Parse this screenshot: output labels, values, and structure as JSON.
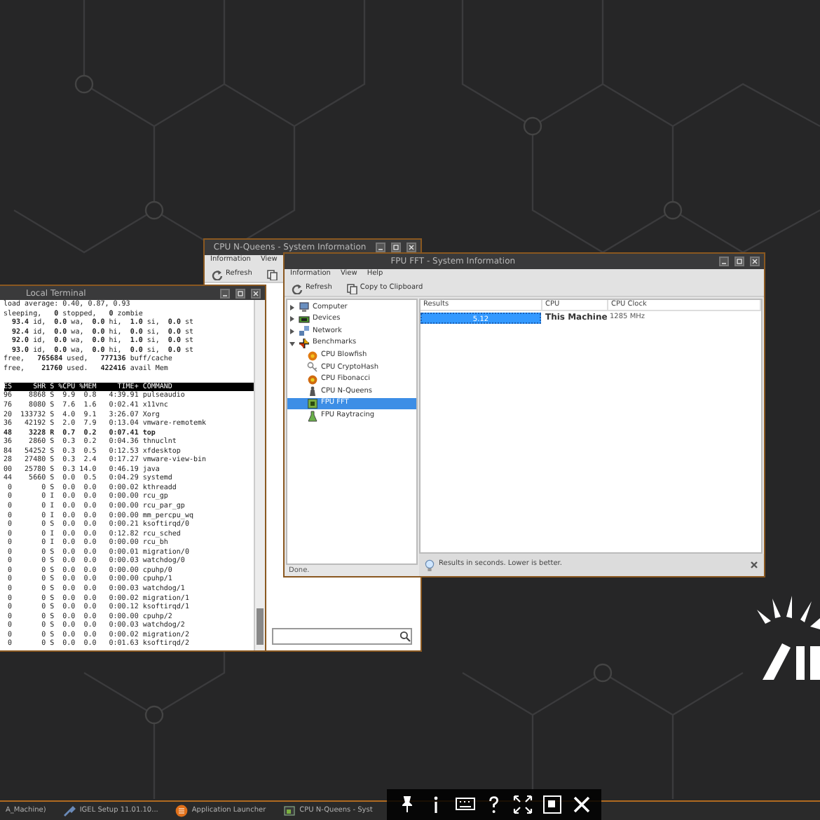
{
  "nqueens_window": {
    "title": "CPU N-Queens - System Information",
    "menu": [
      "Information",
      "View"
    ],
    "toolbar": [
      {
        "label": "Refresh",
        "kind": "refresh"
      },
      {
        "kind": "copy"
      }
    ]
  },
  "terminal": {
    "title": "Local Terminal",
    "summary": [
      "load average: 0.40, 0.87, 0.93",
      "sleeping,   **0** stopped,   **0** zombie",
      "  **93.4** id,  **0.0** wa,  **0.0** hi,  **1.0** si,  **0.0** st",
      "  **92.4** id,  **0.0** wa,  **0.0** hi,  **0.0** si,  **0.0** st",
      "  **92.0** id,  **0.0** wa,  **0.0** hi,  **1.0** si,  **0.0** st",
      "  **93.0** id,  **0.0** wa,  **0.0** hi,  **0.0** si,  **0.0** st",
      "free,   **765684** used,   **777136** buff/cache",
      "free,    **21760** used.   **422416** avail Mem"
    ],
    "header": "ES     SHR S %CPU %MEM     TIME+ COMMAND",
    "processes": [
      {
        "text": "96    8868 S  9.9  0.8   4:39.91 pulseaudio",
        "bold": false
      },
      {
        "text": "76    8080 S  7.6  1.6   0:02.41 x11vnc",
        "bold": false
      },
      {
        "text": "20  133732 S  4.0  9.1   3:26.07 Xorg",
        "bold": false
      },
      {
        "text": "36   42192 S  2.0  7.9   0:13.04 vmware-remotemk",
        "bold": false
      },
      {
        "text": "48    3228 R  0.7  0.2   0:07.41 top",
        "bold": true
      },
      {
        "text": "36    2860 S  0.3  0.2   0:04.36 thnuclnt",
        "bold": false
      },
      {
        "text": "84   54252 S  0.3  0.5   0:12.53 xfdesktop",
        "bold": false
      },
      {
        "text": "28   27480 S  0.3  2.4   0:17.27 vmware-view-bin",
        "bold": false
      },
      {
        "text": "00   25780 S  0.3 14.0   0:46.19 java",
        "bold": false
      },
      {
        "text": "44    5660 S  0.0  0.5   0:04.29 systemd",
        "bold": false
      },
      {
        "text": " 0       0 S  0.0  0.0   0:00.02 kthreadd",
        "bold": false
      },
      {
        "text": " 0       0 I  0.0  0.0   0:00.00 rcu_gp",
        "bold": false
      },
      {
        "text": " 0       0 I  0.0  0.0   0:00.00 rcu_par_gp",
        "bold": false
      },
      {
        "text": " 0       0 I  0.0  0.0   0:00.00 mm_percpu_wq",
        "bold": false
      },
      {
        "text": " 0       0 S  0.0  0.0   0:00.21 ksoftirqd/0",
        "bold": false
      },
      {
        "text": " 0       0 I  0.0  0.0   0:12.82 rcu_sched",
        "bold": false
      },
      {
        "text": " 0       0 I  0.0  0.0   0:00.00 rcu_bh",
        "bold": false
      },
      {
        "text": " 0       0 S  0.0  0.0   0:00.01 migration/0",
        "bold": false
      },
      {
        "text": " 0       0 S  0.0  0.0   0:00.03 watchdog/0",
        "bold": false
      },
      {
        "text": " 0       0 S  0.0  0.0   0:00.00 cpuhp/0",
        "bold": false
      },
      {
        "text": " 0       0 S  0.0  0.0   0:00.00 cpuhp/1",
        "bold": false
      },
      {
        "text": " 0       0 S  0.0  0.0   0:00.03 watchdog/1",
        "bold": false
      },
      {
        "text": " 0       0 S  0.0  0.0   0:00.02 migration/1",
        "bold": false
      },
      {
        "text": " 0       0 S  0.0  0.0   0:00.12 ksoftirqd/1",
        "bold": false
      },
      {
        "text": " 0       0 S  0.0  0.0   0:00.00 cpuhp/2",
        "bold": false
      },
      {
        "text": " 0       0 S  0.0  0.0   0:00.03 watchdog/2",
        "bold": false
      },
      {
        "text": " 0       0 S  0.0  0.0   0:00.02 migration/2",
        "bold": false
      },
      {
        "text": " 0       0 S  0.0  0.0   0:01.63 ksoftirqd/2",
        "bold": false
      }
    ]
  },
  "fpu_window": {
    "title": "FPU FFT - System Information",
    "menu": [
      "Information",
      "View",
      "Help"
    ],
    "toolbar": [
      {
        "label": "Refresh",
        "kind": "refresh"
      },
      {
        "label": "Copy to Clipboard",
        "kind": "copy"
      }
    ],
    "tree": [
      {
        "label": "Computer",
        "kind": "computer",
        "expanded": false,
        "selected": false
      },
      {
        "label": "Devices",
        "kind": "devices",
        "expanded": false,
        "selected": false
      },
      {
        "label": "Network",
        "kind": "network",
        "expanded": false,
        "selected": false
      },
      {
        "label": "Benchmarks",
        "kind": "benchmarks",
        "expanded": true,
        "selected": false,
        "children": [
          {
            "label": "CPU Blowfish",
            "kind": "blowfish",
            "selected": false
          },
          {
            "label": "CPU CryptoHash",
            "kind": "cryptohash",
            "selected": false
          },
          {
            "label": "CPU Fibonacci",
            "kind": "fibonacci",
            "selected": false
          },
          {
            "label": "CPU N-Queens",
            "kind": "nqueens",
            "selected": false
          },
          {
            "label": "FPU FFT",
            "kind": "fft",
            "selected": true
          },
          {
            "label": "FPU Raytracing",
            "kind": "raytracing",
            "selected": false
          }
        ]
      }
    ],
    "columns": [
      "Results",
      "CPU",
      "CPU Clock"
    ],
    "rows": [
      {
        "result": "5.12",
        "cpu": "This Machine",
        "clock": "1285 MHz",
        "selected": true
      }
    ],
    "note": "Results in seconds. Lower is better.",
    "status": "Done."
  },
  "taskbar": [
    {
      "label": "A_Machine)",
      "kind": "plain"
    },
    {
      "label": "IGEL Setup 11.01.10...",
      "kind": "setup"
    },
    {
      "label": "Application Launcher",
      "kind": "launcher"
    },
    {
      "label": "CPU N-Queens - Syst",
      "kind": "window"
    }
  ]
}
